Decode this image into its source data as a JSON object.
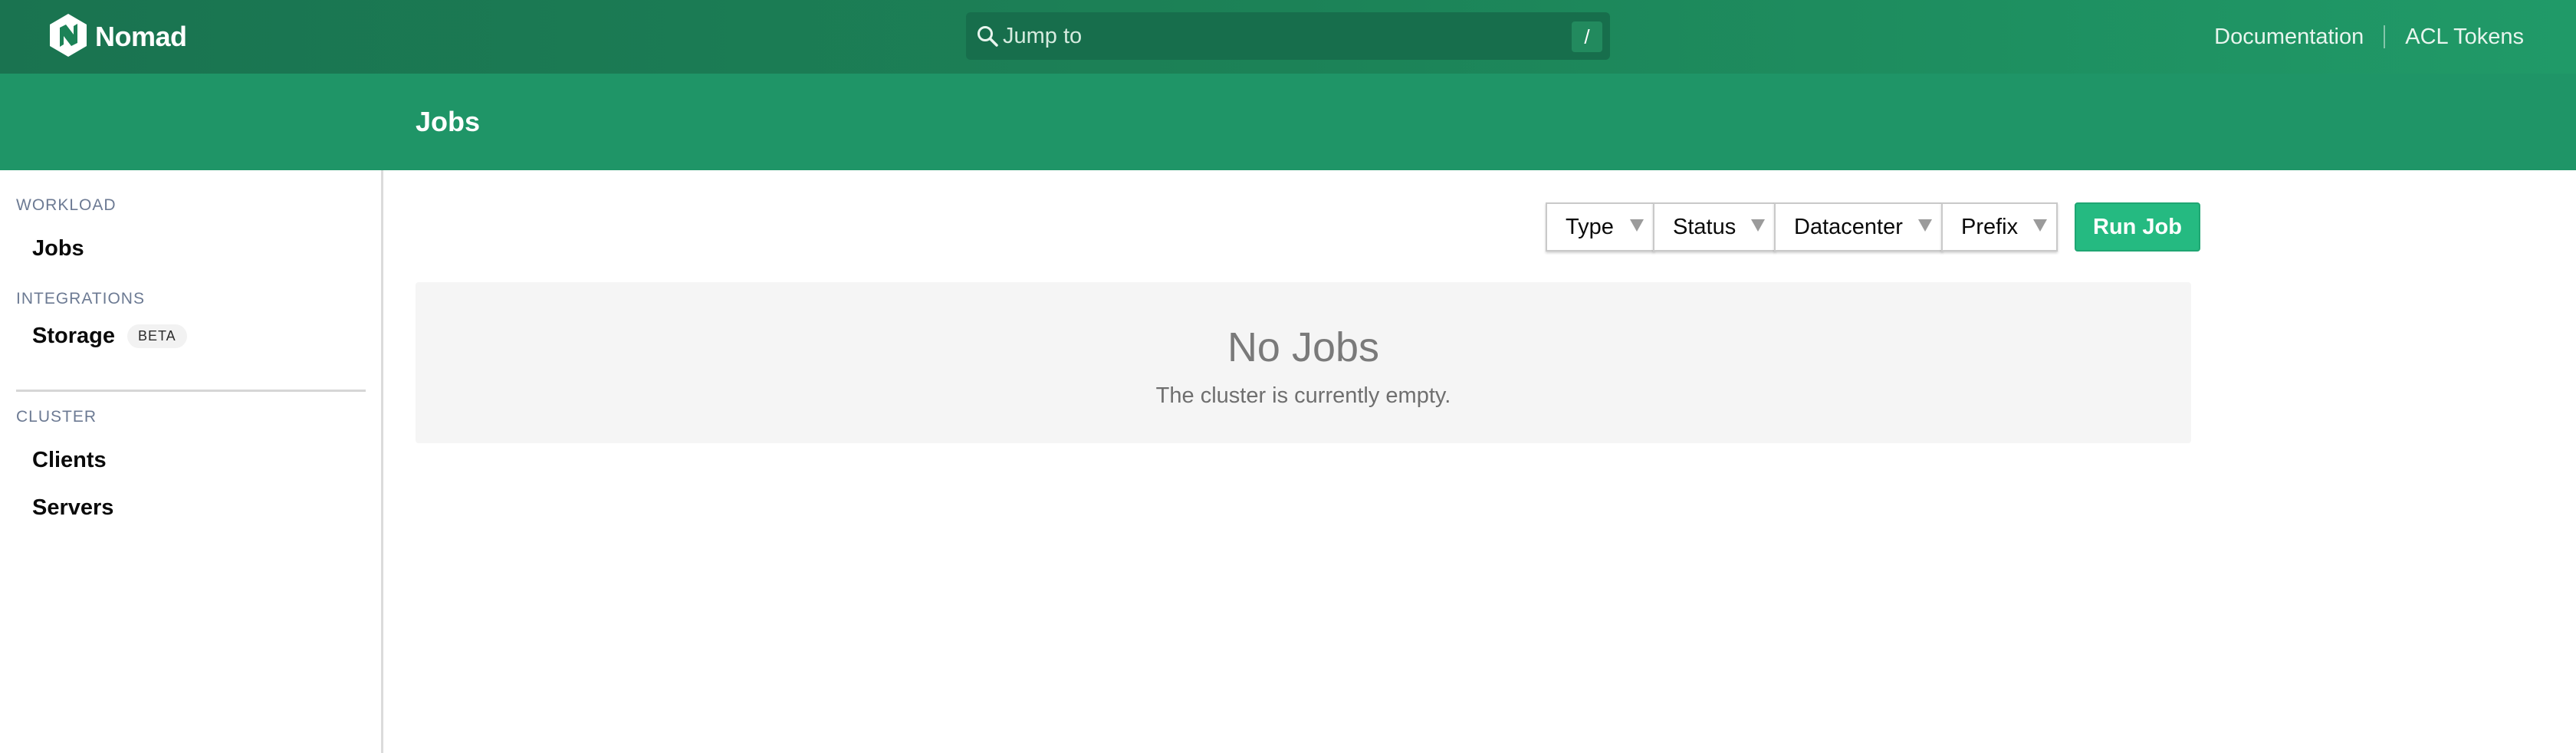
{
  "brand": {
    "name": "Nomad",
    "logo_icon": "nomad-logo-icon"
  },
  "search": {
    "placeholder": "Jump to",
    "shortcut": "/",
    "icon": "search-icon"
  },
  "nav": {
    "documentation": "Documentation",
    "acl_tokens": "ACL Tokens"
  },
  "page": {
    "title": "Jobs"
  },
  "sidebar": {
    "workload_label": "WORKLOAD",
    "jobs": "Jobs",
    "integrations_label": "INTEGRATIONS",
    "storage": "Storage",
    "storage_badge": "BETA",
    "cluster_label": "CLUSTER",
    "clients": "Clients",
    "servers": "Servers"
  },
  "filters": {
    "type": "Type",
    "status": "Status",
    "datacenter": "Datacenter",
    "prefix": "Prefix"
  },
  "actions": {
    "run_job": "Run Job"
  },
  "empty": {
    "headline": "No Jobs",
    "message": "The cluster is currently empty."
  },
  "colors": {
    "navbar": "#1c8257",
    "subnav": "#1f9567",
    "primary_button": "#25ba81"
  }
}
